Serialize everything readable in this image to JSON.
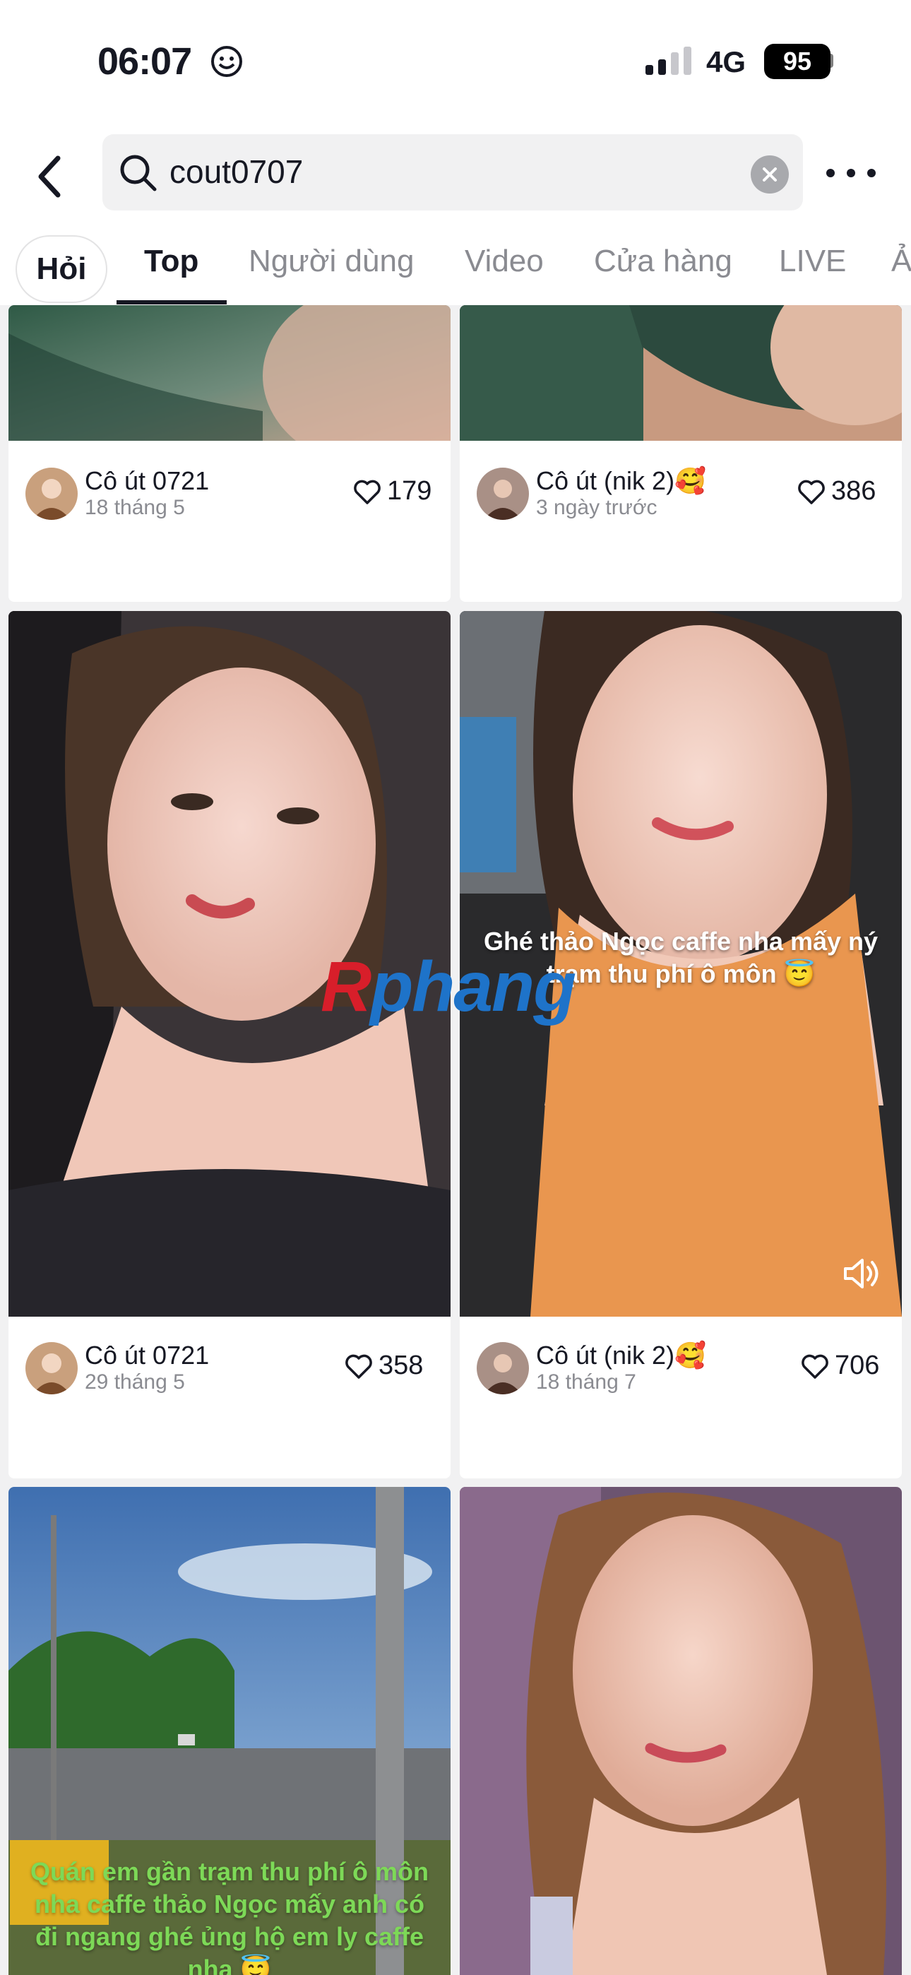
{
  "status_bar": {
    "time": "06:07",
    "network": "4G",
    "battery": "95"
  },
  "search": {
    "query": "cout0707"
  },
  "tabs": {
    "ask": "Hỏi",
    "items": [
      "Top",
      "Người dùng",
      "Video",
      "Cửa hàng",
      "LIVE",
      "Ả"
    ],
    "active": "Top"
  },
  "cards": [
    {
      "author": "Cô út 0721",
      "date": "18 tháng 5",
      "likes": "179"
    },
    {
      "author": "Cô út (nik 2)🥰",
      "date": "3 ngày trước",
      "likes": "386"
    },
    {
      "author": "Cô út 0721",
      "date": "29 tháng 5",
      "likes": "358"
    },
    {
      "author": "Cô út (nik 2)🥰",
      "date": "18 tháng 7",
      "likes": "706",
      "caption": "Ghé thảo Ngọc caffe nha mấy ný trạm thu phí ô môn 😇"
    },
    {
      "caption": "Quán em gần trạm thu phí ô môn nha caffe thảo Ngọc mấy anh có đi ngang ghé ủng hộ em ly caffe nha 😇"
    },
    {}
  ],
  "watermark": {
    "part1": "R",
    "part2": "phang"
  },
  "colors": {
    "accent": "#161823",
    "muted": "#8a8b91",
    "background": "#f1f1f2"
  }
}
